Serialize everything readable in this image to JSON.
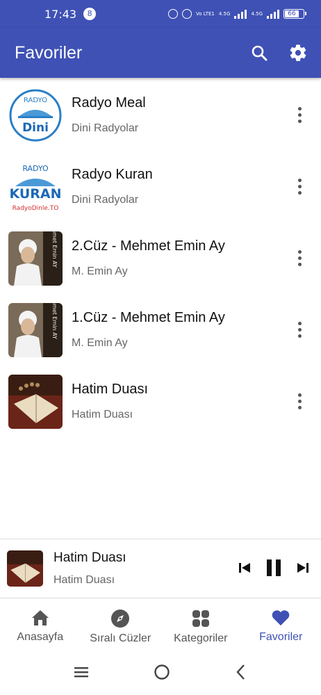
{
  "status_bar": {
    "time": "17:43",
    "notification_count": "8",
    "network_label_1": "4.5G",
    "network_label_2": "4.5G",
    "volte_label": "Vo LTE1",
    "battery": "66"
  },
  "app_bar": {
    "title": "Favoriler",
    "search_icon": "search-icon",
    "settings_icon": "gear-icon"
  },
  "favorites": [
    {
      "title": "Radyo Meal",
      "subtitle": "Dini Radyolar",
      "logo_text_top": "RADYO",
      "logo_text_main": "Dini"
    },
    {
      "title": "Radyo Kuran",
      "subtitle": "Dini Radyolar",
      "logo_text_top": "RADYO",
      "logo_text_main": "KURAN",
      "logo_text_bottom": "RadyoDinle.TO"
    },
    {
      "title": "2.Cüz - Mehmet Emin Ay",
      "subtitle": "M. Emin Ay",
      "thumb_text": "Mehmet Emin AY"
    },
    {
      "title": "1.Cüz - Mehmet Emin Ay",
      "subtitle": "M. Emin Ay",
      "thumb_text": "Mehmet Emin AY"
    },
    {
      "title": "Hatim Duası",
      "subtitle": "Hatim Duası"
    }
  ],
  "player": {
    "title": "Hatim Duası",
    "subtitle": "Hatim Duası"
  },
  "nav": [
    {
      "label": "Anasayfa",
      "icon": "home-icon"
    },
    {
      "label": "Sıralı Cüzler",
      "icon": "compass-icon"
    },
    {
      "label": "Kategoriler",
      "icon": "grid-icon"
    },
    {
      "label": "Favoriler",
      "icon": "heart-icon",
      "active": true
    }
  ],
  "colors": {
    "primary": "#3f51b5",
    "text": "#111111",
    "subtext": "#666666"
  }
}
